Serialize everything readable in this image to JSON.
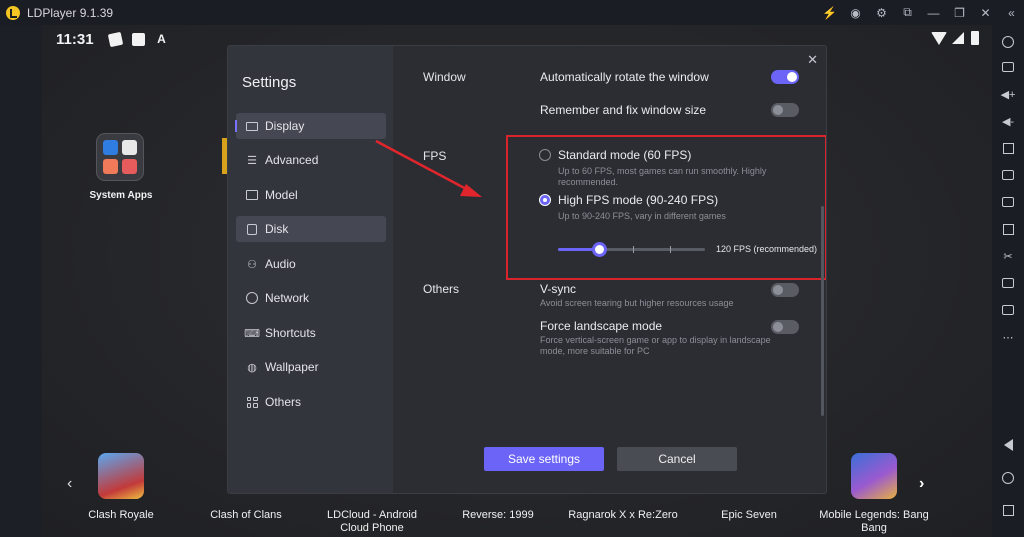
{
  "titlebar": {
    "app_title": "LDPlayer 9.1.39",
    "icons": [
      "bolt-icon",
      "account-icon",
      "settings-icon",
      "multi-window-icon",
      "minimize-icon",
      "restore-icon",
      "close-icon",
      "collapse-icon"
    ]
  },
  "statusbar": {
    "time": "11:31",
    "badge_a": "A"
  },
  "desktop": {
    "system_apps_label": "System Apps"
  },
  "dock": {
    "apps": [
      {
        "label": "Clash Royale"
      },
      {
        "label": "Clash of Clans"
      },
      {
        "label": "LDCloud - Android Cloud Phone"
      },
      {
        "label": "Reverse: 1999"
      },
      {
        "label": "Ragnarok X x Re:Zero"
      },
      {
        "label": "Epic Seven"
      },
      {
        "label": "Mobile Legends: Bang Bang"
      }
    ]
  },
  "settings": {
    "title": "Settings",
    "nav": [
      {
        "label": "Display",
        "icon": "monitor-icon",
        "state": "active"
      },
      {
        "label": "Advanced",
        "icon": "sliders-icon"
      },
      {
        "label": "Model",
        "icon": "folder-icon"
      },
      {
        "label": "Disk",
        "icon": "disk-icon",
        "state": "hover"
      },
      {
        "label": "Audio",
        "icon": "gamepad-icon"
      },
      {
        "label": "Network",
        "icon": "globe-icon"
      },
      {
        "label": "Shortcuts",
        "icon": "keyboard-icon"
      },
      {
        "label": "Wallpaper",
        "icon": "palette-icon"
      },
      {
        "label": "Others",
        "icon": "grid-icon"
      }
    ],
    "window": {
      "section": "Window",
      "auto_rotate": {
        "label": "Automatically rotate the window",
        "on": true
      },
      "remember_size": {
        "label": "Remember and fix window size",
        "on": false
      }
    },
    "fps": {
      "section": "FPS",
      "standard": {
        "label": "Standard mode (60 FPS)",
        "desc": "Up to 60 FPS, most games can run smoothly. Highly recommended.",
        "selected": false
      },
      "high": {
        "label": "High FPS mode (90-240 FPS)",
        "desc": "Up to 90-240 FPS, vary in different games",
        "selected": true
      },
      "slider_value_label": "120 FPS (recommended)",
      "slider_fraction": 0.28
    },
    "others": {
      "section": "Others",
      "vsync": {
        "label": "V-sync",
        "desc": "Avoid screen tearing but higher resources usage",
        "on": false
      },
      "landscape": {
        "label": "Force landscape mode",
        "desc": "Force vertical-screen game or app to display in landscape mode, more suitable for PC",
        "on": false
      }
    },
    "save_label": "Save settings",
    "cancel_label": "Cancel"
  },
  "colors": {
    "accent": "#6b64f6",
    "highlight_box": "#d8242a",
    "arrow": "#e0262c"
  }
}
